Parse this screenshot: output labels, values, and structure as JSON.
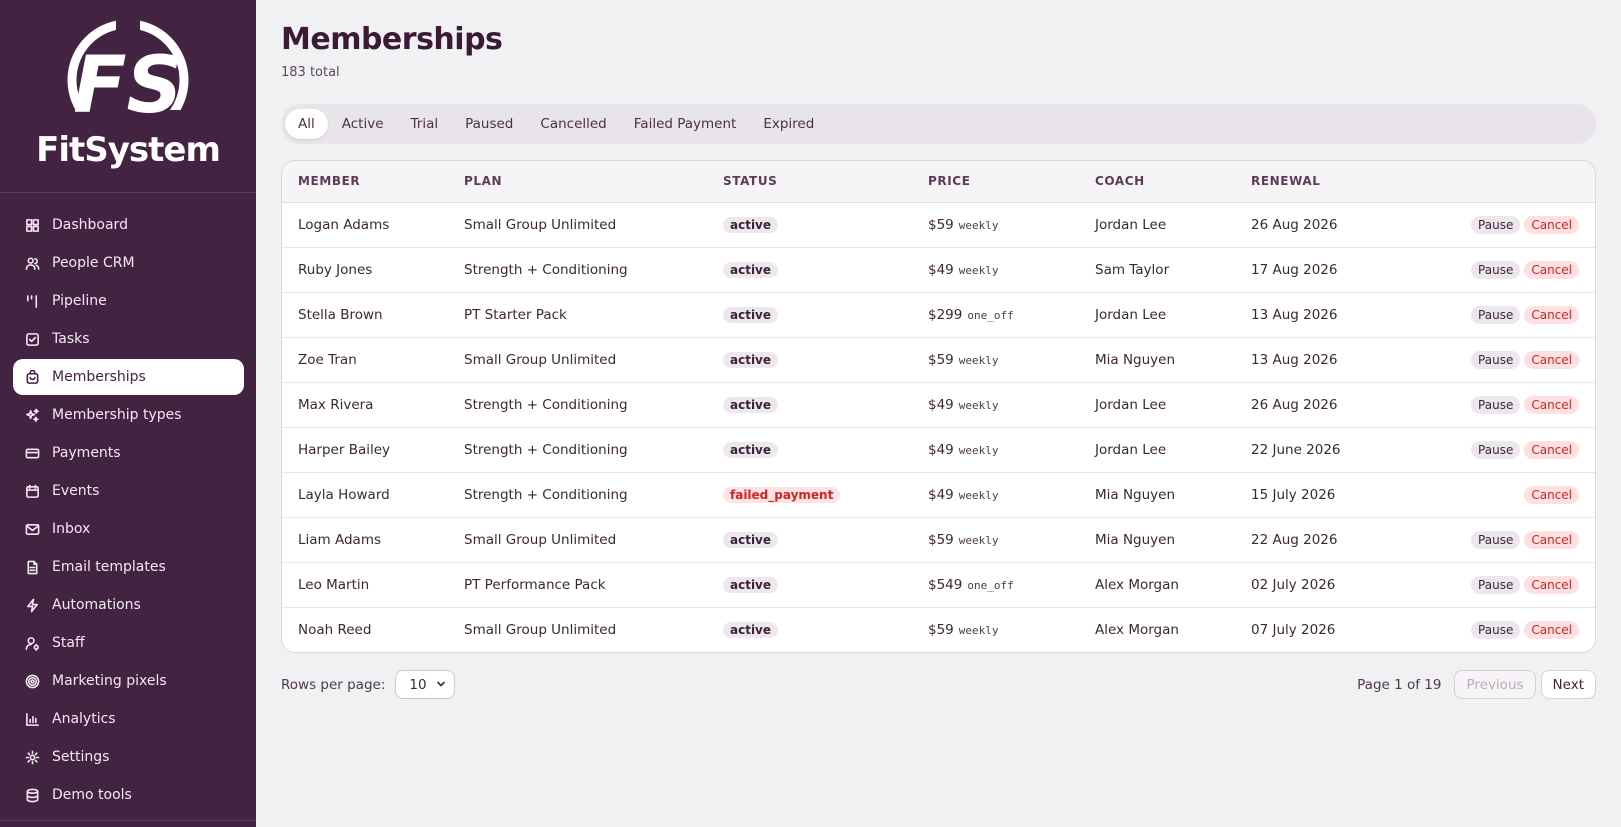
{
  "brand": {
    "logo_mark": "FS",
    "name": "FitSystem"
  },
  "sidebar": {
    "items": [
      {
        "label": "Dashboard",
        "icon": "dashboard-icon"
      },
      {
        "label": "People CRM",
        "icon": "people-icon"
      },
      {
        "label": "Pipeline",
        "icon": "pipeline-icon"
      },
      {
        "label": "Tasks",
        "icon": "tasks-icon"
      },
      {
        "label": "Memberships",
        "icon": "memberships-icon",
        "active": true
      },
      {
        "label": "Membership types",
        "icon": "sparkles-icon"
      },
      {
        "label": "Payments",
        "icon": "credit-card-icon"
      },
      {
        "label": "Events",
        "icon": "calendar-icon"
      },
      {
        "label": "Inbox",
        "icon": "mail-icon"
      },
      {
        "label": "Email templates",
        "icon": "document-icon"
      },
      {
        "label": "Automations",
        "icon": "lightning-icon"
      },
      {
        "label": "Staff",
        "icon": "staff-icon"
      },
      {
        "label": "Marketing pixels",
        "icon": "target-icon"
      },
      {
        "label": "Analytics",
        "icon": "bar-chart-icon"
      },
      {
        "label": "Settings",
        "icon": "gear-icon"
      },
      {
        "label": "Demo tools",
        "icon": "database-icon"
      }
    ]
  },
  "header": {
    "title": "Memberships",
    "total": "183 total"
  },
  "tabs": [
    "All",
    "Active",
    "Trial",
    "Paused",
    "Cancelled",
    "Failed Payment",
    "Expired"
  ],
  "table": {
    "columns": [
      "MEMBER",
      "PLAN",
      "STATUS",
      "PRICE",
      "COACH",
      "RENEWAL"
    ],
    "rows": [
      {
        "member": "Logan Adams",
        "plan": "Small Group Unlimited",
        "status": "active",
        "price": "$59",
        "unit": "weekly",
        "coach": "Jordan Lee",
        "renewal": "26 Aug 2026",
        "pause": "Pause",
        "cancel": "Cancel"
      },
      {
        "member": "Ruby Jones",
        "plan": "Strength + Conditioning",
        "status": "active",
        "price": "$49",
        "unit": "weekly",
        "coach": "Sam Taylor",
        "renewal": "17 Aug 2026",
        "pause": "Pause",
        "cancel": "Cancel"
      },
      {
        "member": "Stella Brown",
        "plan": "PT Starter Pack",
        "status": "active",
        "price": "$299",
        "unit": "one_off",
        "coach": "Jordan Lee",
        "renewal": "13 Aug 2026",
        "pause": "Pause",
        "cancel": "Cancel"
      },
      {
        "member": "Zoe Tran",
        "plan": "Small Group Unlimited",
        "status": "active",
        "price": "$59",
        "unit": "weekly",
        "coach": "Mia Nguyen",
        "renewal": "13 Aug 2026",
        "pause": "Pause",
        "cancel": "Cancel"
      },
      {
        "member": "Max Rivera",
        "plan": "Strength + Conditioning",
        "status": "active",
        "price": "$49",
        "unit": "weekly",
        "coach": "Jordan Lee",
        "renewal": "26 Aug 2026",
        "pause": "Pause",
        "cancel": "Cancel"
      },
      {
        "member": "Harper Bailey",
        "plan": "Strength + Conditioning",
        "status": "active",
        "price": "$49",
        "unit": "weekly",
        "coach": "Jordan Lee",
        "renewal": "22 June 2026",
        "pause": "Pause",
        "cancel": "Cancel"
      },
      {
        "member": "Layla Howard",
        "plan": "Strength + Conditioning",
        "status": "failed_payment",
        "price": "$49",
        "unit": "weekly",
        "coach": "Mia Nguyen",
        "renewal": "15 July 2026",
        "pause": null,
        "cancel": "Cancel"
      },
      {
        "member": "Liam Adams",
        "plan": "Small Group Unlimited",
        "status": "active",
        "price": "$59",
        "unit": "weekly",
        "coach": "Mia Nguyen",
        "renewal": "22 Aug 2026",
        "pause": "Pause",
        "cancel": "Cancel"
      },
      {
        "member": "Leo Martin",
        "plan": "PT Performance Pack",
        "status": "active",
        "price": "$549",
        "unit": "one_off",
        "coach": "Alex Morgan",
        "renewal": "02 July 2026",
        "pause": "Pause",
        "cancel": "Cancel"
      },
      {
        "member": "Noah Reed",
        "plan": "Small Group Unlimited",
        "status": "active",
        "price": "$59",
        "unit": "weekly",
        "coach": "Alex Morgan",
        "renewal": "07 July 2026",
        "pause": "Pause",
        "cancel": "Cancel"
      }
    ]
  },
  "pagination": {
    "rows_label": "Rows per page:",
    "rows_value": "10",
    "page_info": "Page 1 of 19",
    "previous": "Previous",
    "next": "Next"
  },
  "colors": {
    "sidebar_bg": "#432342",
    "accent": "#3b1a35",
    "danger": "#d32424",
    "page_bg": "#f1f0f3"
  }
}
